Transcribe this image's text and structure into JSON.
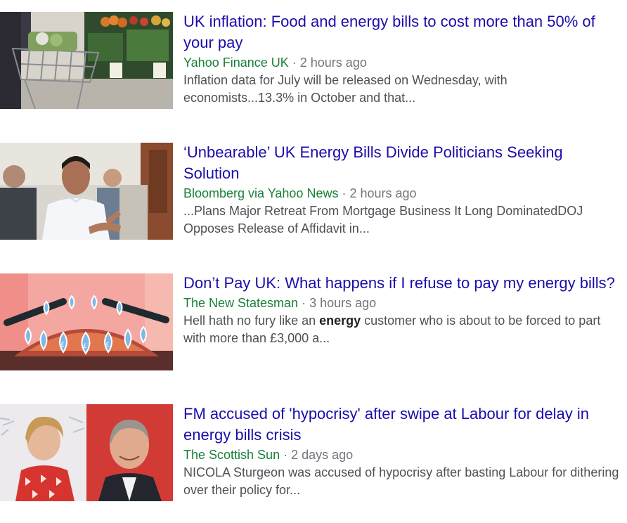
{
  "articles": [
    {
      "headline": "UK inflation: Food and energy bills to cost more than 50% of your pay",
      "source": "Yahoo Finance UK",
      "separator": " · ",
      "time": "2 hours ago",
      "snippet_before": "Inflation data for July will be released on Wednesday, with economists...13.3% in October and that...",
      "snippet_bold": "",
      "snippet_after": "",
      "thumbnail_icon": "shopping-trolley-supermarket-photo"
    },
    {
      "headline": "‘Unbearable’ UK Energy Bills Divide Politicians Seeking Solution",
      "source": "Bloomberg via Yahoo News",
      "separator": " · ",
      "time": "2 hours ago",
      "snippet_before": "...Plans Major Retreat From Mortgage Business It Long DominatedDOJ Opposes Release of Affidavit in...",
      "snippet_bold": "",
      "snippet_after": "",
      "thumbnail_icon": "politician-speaking-photo"
    },
    {
      "headline": "Don’t Pay UK: What happens if I refuse to pay my energy bills?",
      "source": "The New Statesman",
      "separator": " · ",
      "time": "3 hours ago",
      "snippet_before": "Hell hath no fury like an ",
      "snippet_bold": "energy",
      "snippet_after": " customer who is about to be forced to part with more than £3,000 a...",
      "thumbnail_icon": "gas-hob-flames-illustration"
    },
    {
      "headline": "FM accused of 'hypocrisy' after swipe at Labour for delay in energy bills crisis",
      "source": "The Scottish Sun",
      "separator": " · ",
      "time": "2 days ago",
      "snippet_before": "NICOLA Sturgeon was accused of hypocrisy after basting Labour for dithering over their policy for...",
      "snippet_bold": "",
      "snippet_after": "",
      "thumbnail_icon": "two-politicians-portrait-photo"
    }
  ],
  "colors": {
    "headline": "#1a0dab",
    "source": "#188038",
    "meta": "#70757a",
    "snippet": "#4d5156"
  }
}
